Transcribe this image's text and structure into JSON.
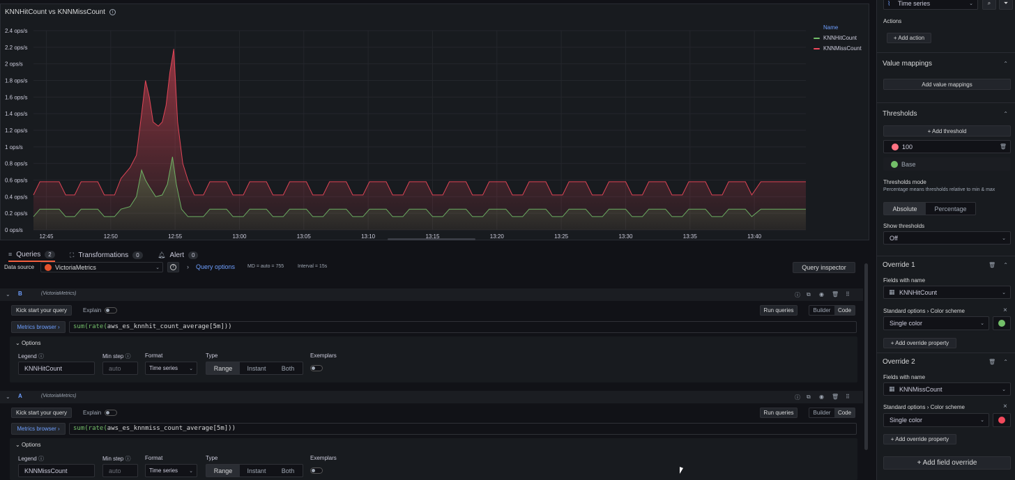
{
  "panel": {
    "title": "KNNHitCount vs KNNMissCount",
    "legend_header": "Name",
    "legend": [
      {
        "name": "KNNHitCount",
        "color": "#73bf69"
      },
      {
        "name": "KNNMissCount",
        "color": "#f2495c"
      }
    ]
  },
  "chart_data": {
    "type": "area",
    "title": "KNNHitCount vs KNNMissCount",
    "ylabel": "",
    "xlabel": "",
    "ylim": [
      0,
      2.4
    ],
    "y_ticks": [
      "0 ops/s",
      "0.2 ops/s",
      "0.4 ops/s",
      "0.6 ops/s",
      "0.8 ops/s",
      "1 ops/s",
      "1.2 ops/s",
      "1.4 ops/s",
      "1.6 ops/s",
      "1.8 ops/s",
      "2 ops/s",
      "2.2 ops/s",
      "2.4 ops/s"
    ],
    "x_ticks": [
      "12:45",
      "12:50",
      "12:55",
      "13:00",
      "13:05",
      "13:10",
      "13:15",
      "13:20",
      "13:25",
      "13:30",
      "13:35",
      "13:40"
    ],
    "x_range_minutes": [
      "12:44",
      "13:44"
    ],
    "grid": true,
    "legend_position": "right",
    "series": [
      {
        "name": "KNNMissCount",
        "color": "#f2495c",
        "points": [
          [
            "12:44",
            0.42
          ],
          [
            "12:44.5",
            0.58
          ],
          [
            "12:46",
            0.58
          ],
          [
            "12:46.5",
            0.42
          ],
          [
            "12:47.2",
            0.42
          ],
          [
            "12:47.7",
            0.58
          ],
          [
            "12:49",
            0.58
          ],
          [
            "12:49.5",
            0.42
          ],
          [
            "12:50.3",
            0.42
          ],
          [
            "12:50.8",
            0.62
          ],
          [
            "12:51.5",
            0.75
          ],
          [
            "12:52",
            0.9
          ],
          [
            "12:52.4",
            1.4
          ],
          [
            "12:52.7",
            1.8
          ],
          [
            "12:53",
            1.6
          ],
          [
            "12:53.3",
            1.3
          ],
          [
            "12:53.7",
            1.25
          ],
          [
            "12:54",
            1.3
          ],
          [
            "12:54.3",
            1.5
          ],
          [
            "12:54.6",
            1.9
          ],
          [
            "12:54.9",
            2.18
          ],
          [
            "12:55.2",
            1.3
          ],
          [
            "12:55.6",
            0.8
          ],
          [
            "12:56",
            0.6
          ],
          [
            "12:56.5",
            0.42
          ],
          [
            "12:57.2",
            0.42
          ],
          [
            "12:57.7",
            0.58
          ],
          [
            "12:59",
            0.58
          ],
          [
            "12:59.5",
            0.42
          ],
          [
            "13:40",
            0.42
          ],
          [
            "13:40.5",
            0.58
          ],
          [
            "13:44",
            0.58
          ]
        ]
      },
      {
        "name": "KNNHitCount",
        "color": "#73bf69",
        "points": [
          [
            "12:44",
            0.16
          ],
          [
            "12:44.5",
            0.25
          ],
          [
            "12:46",
            0.25
          ],
          [
            "12:46.5",
            0.16
          ],
          [
            "12:47.2",
            0.16
          ],
          [
            "12:47.7",
            0.25
          ],
          [
            "12:49",
            0.25
          ],
          [
            "12:49.5",
            0.16
          ],
          [
            "12:50.3",
            0.16
          ],
          [
            "12:50.8",
            0.25
          ],
          [
            "12:51.5",
            0.28
          ],
          [
            "12:52",
            0.4
          ],
          [
            "12:52.4",
            0.72
          ],
          [
            "12:52.7",
            0.6
          ],
          [
            "12:53",
            0.52
          ],
          [
            "12:53.5",
            0.4
          ],
          [
            "12:54",
            0.42
          ],
          [
            "12:54.4",
            0.55
          ],
          [
            "12:54.8",
            0.88
          ],
          [
            "12:55.1",
            0.55
          ],
          [
            "12:55.5",
            0.25
          ],
          [
            "12:56",
            0.16
          ],
          [
            "12:57.2",
            0.16
          ],
          [
            "12:57.7",
            0.25
          ],
          [
            "12:59",
            0.25
          ],
          [
            "12:59.5",
            0.16
          ],
          [
            "13:40",
            0.16
          ],
          [
            "13:40.5",
            0.25
          ],
          [
            "13:44",
            0.25
          ]
        ]
      }
    ]
  },
  "tabs": [
    {
      "label": "Queries",
      "count": "2",
      "icon": "database-icon"
    },
    {
      "label": "Transformations",
      "count": "0",
      "icon": "transform-icon"
    },
    {
      "label": "Alert",
      "count": "0",
      "icon": "bell-icon"
    }
  ],
  "toolbar": {
    "datasource_label": "Data source",
    "datasource_value": "VictoriaMetrics",
    "query_options": "Query options",
    "md_info": "MD = auto = 755",
    "interval_info": "Interval = 15s",
    "query_inspector": "Query inspector"
  },
  "queries": [
    {
      "ref": "B",
      "datasource": "(VictoriaMetrics)",
      "kickstart": "Kick start your query",
      "explain": "Explain",
      "run": "Run queries",
      "builder": "Builder",
      "code": "Code",
      "metrics_browser": "Metrics browser ›",
      "expr_fn": "sum(rate(",
      "expr_metric": "aws_es_knnhit_count_average",
      "expr_tail": "[5m]))",
      "options_label": "Options",
      "legend_label": "Legend",
      "legend_value": "KNNHitCount",
      "minstep_label": "Min step",
      "minstep_placeholder": "auto",
      "format_label": "Format",
      "format_value": "Time series",
      "type_label": "Type",
      "type_options": [
        "Range",
        "Instant",
        "Both"
      ],
      "type_selected": "Range",
      "exemplars_label": "Exemplars"
    },
    {
      "ref": "A",
      "datasource": "(VictoriaMetrics)",
      "kickstart": "Kick start your query",
      "explain": "Explain",
      "run": "Run queries",
      "builder": "Builder",
      "code": "Code",
      "metrics_browser": "Metrics browser ›",
      "expr_fn": "sum(rate(",
      "expr_metric": "aws_es_knnmiss_count_average",
      "expr_tail": "[5m]))",
      "options_label": "Options",
      "legend_label": "Legend",
      "legend_value": "KNNMissCount",
      "minstep_label": "Min step",
      "minstep_placeholder": "auto",
      "format_label": "Format",
      "format_value": "Time series",
      "type_label": "Type",
      "type_options": [
        "Range",
        "Instant",
        "Both"
      ],
      "type_selected": "Range",
      "exemplars_label": "Exemplars"
    }
  ],
  "right": {
    "viz_value": "Time series",
    "actions_label": "Actions",
    "add_action": "+ Add action",
    "value_mappings_title": "Value mappings",
    "add_value_mappings": "Add value mappings",
    "thresholds_title": "Thresholds",
    "add_threshold": "+ Add threshold",
    "threshold_value": "100",
    "threshold_color": "#ff7383",
    "base_label": "Base",
    "base_color": "#73bf69",
    "mode_label": "Thresholds mode",
    "mode_desc": "Percentage means thresholds relative to min & max",
    "mode_absolute": "Absolute",
    "mode_percentage": "Percentage",
    "show_thresholds_label": "Show thresholds",
    "show_thresholds_value": "Off",
    "overrides": [
      {
        "title": "Override 1",
        "fields_label": "Fields with name",
        "field_value": "KNNHitCount",
        "prop_path_a": "Standard options",
        "prop_path_b": "Color scheme",
        "color_mode": "Single color",
        "color": "#73bf69",
        "add_prop": "+ Add override property"
      },
      {
        "title": "Override 2",
        "fields_label": "Fields with name",
        "field_value": "KNNMissCount",
        "prop_path_a": "Standard options",
        "prop_path_b": "Color scheme",
        "color_mode": "Single color",
        "color": "#f2495c",
        "add_prop": "+ Add override property"
      }
    ],
    "add_field_override": "+ Add field override"
  }
}
